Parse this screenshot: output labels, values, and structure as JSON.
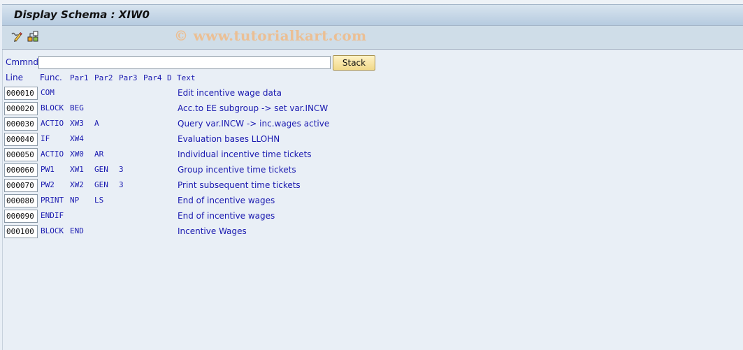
{
  "window": {
    "title": "Display Schema : XIW0"
  },
  "toolbar": {
    "icons": [
      "display-change-icon",
      "hierarchy-icon"
    ],
    "watermark": "© www.tutorialkart.com"
  },
  "command": {
    "label": "Cmmnd",
    "value": "",
    "stack_label": "Stack"
  },
  "columns": {
    "line": "Line",
    "func": "Func.",
    "par1": "Par1",
    "par2": "Par2",
    "par3": "Par3",
    "par4": "Par4",
    "d": "D",
    "text": "Text"
  },
  "rows": [
    {
      "line": "000010",
      "func": "COM",
      "par1": "",
      "par2": "",
      "par3": "",
      "par4": "",
      "d": "",
      "text": "Edit incentive wage data"
    },
    {
      "line": "000020",
      "func": "BLOCK",
      "par1": "BEG",
      "par2": "",
      "par3": "",
      "par4": "",
      "d": "",
      "text": "Acc.to EE subgroup -> set var.INCW"
    },
    {
      "line": "000030",
      "func": "ACTIO",
      "par1": "XW3",
      "par2": "A",
      "par3": "",
      "par4": "",
      "d": "",
      "text": "Query var.INCW -> inc.wages active"
    },
    {
      "line": "000040",
      "func": "IF",
      "par1": "XW4",
      "par2": "",
      "par3": "",
      "par4": "",
      "d": "",
      "text": "Evaluation bases LLOHN"
    },
    {
      "line": "000050",
      "func": "ACTIO",
      "par1": "XW0",
      "par2": "AR",
      "par3": "",
      "par4": "",
      "d": "",
      "text": "Individual incentive time tickets"
    },
    {
      "line": "000060",
      "func": "PW1",
      "par1": "XW1",
      "par2": "GEN",
      "par3": "3",
      "par4": "",
      "d": "",
      "text": "Group incentive time tickets"
    },
    {
      "line": "000070",
      "func": "PW2",
      "par1": "XW2",
      "par2": "GEN",
      "par3": "3",
      "par4": "",
      "d": "",
      "text": "Print subsequent time tickets"
    },
    {
      "line": "000080",
      "func": "PRINT",
      "par1": "NP",
      "par2": "LS",
      "par3": "",
      "par4": "",
      "d": "",
      "text": "End of incentive wages"
    },
    {
      "line": "000090",
      "func": "ENDIF",
      "par1": "",
      "par2": "",
      "par3": "",
      "par4": "",
      "d": "",
      "text": "End of incentive wages"
    },
    {
      "line": "000100",
      "func": "BLOCK",
      "par1": "END",
      "par2": "",
      "par3": "",
      "par4": "",
      "d": "",
      "text": "Incentive Wages"
    }
  ]
}
